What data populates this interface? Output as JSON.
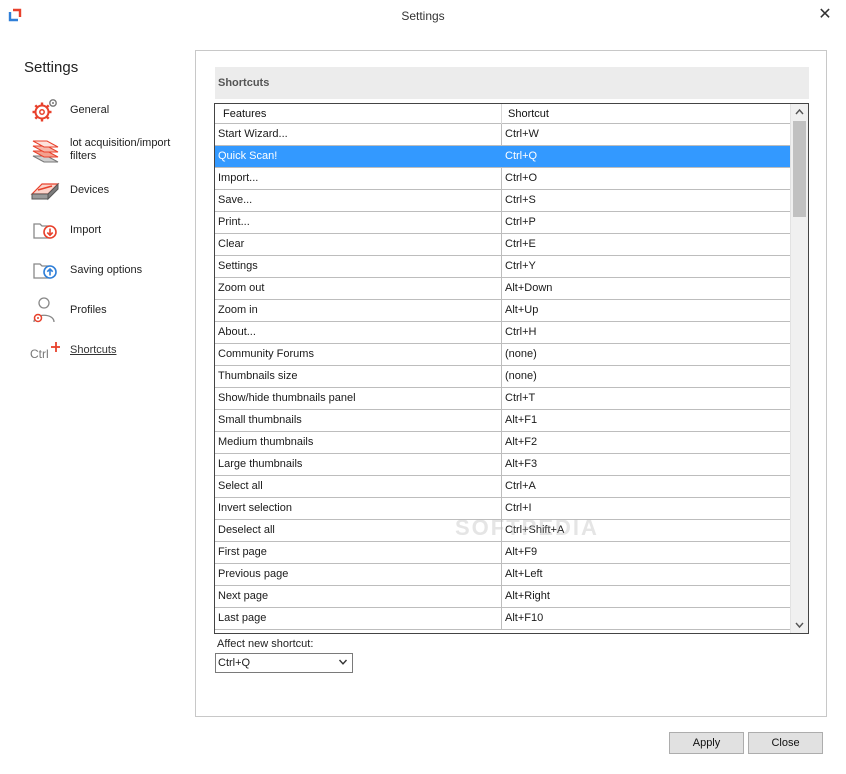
{
  "window": {
    "title": "Settings",
    "close_glyph": "✕"
  },
  "sidebar": {
    "title": "Settings",
    "items": [
      {
        "label": "General",
        "icon": "gear-icon"
      },
      {
        "label": "lot acquisition/import filters",
        "icon": "document-stack-icon"
      },
      {
        "label": "Devices",
        "icon": "scanner-icon"
      },
      {
        "label": "Import",
        "icon": "import-icon"
      },
      {
        "label": "Saving options",
        "icon": "save-upload-icon"
      },
      {
        "label": "Profiles",
        "icon": "user-gear-icon"
      },
      {
        "label": "Shortcuts",
        "icon": "ctrl-shortcut-icon"
      }
    ]
  },
  "section": {
    "title": "Shortcuts"
  },
  "grid": {
    "columns": [
      "Features",
      "Shortcut"
    ],
    "rows": [
      [
        "Start Wizard...",
        "Ctrl+W"
      ],
      [
        "Quick Scan!",
        "Ctrl+Q"
      ],
      [
        "Import...",
        "Ctrl+O"
      ],
      [
        "Save...",
        "Ctrl+S"
      ],
      [
        "Print...",
        "Ctrl+P"
      ],
      [
        "Clear",
        "Ctrl+E"
      ],
      [
        "Settings",
        "Ctrl+Y"
      ],
      [
        "Zoom out",
        "Alt+Down"
      ],
      [
        "Zoom in",
        "Alt+Up"
      ],
      [
        "About...",
        "Ctrl+H"
      ],
      [
        "Community Forums",
        "(none)"
      ],
      [
        "Thumbnails size",
        "(none)"
      ],
      [
        "Show/hide thumbnails panel",
        "Ctrl+T"
      ],
      [
        "Small thumbnails",
        "Alt+F1"
      ],
      [
        "Medium thumbnails",
        "Alt+F2"
      ],
      [
        "Large thumbnails",
        "Alt+F3"
      ],
      [
        "Select all",
        "Ctrl+A"
      ],
      [
        "Invert selection",
        "Ctrl+I"
      ],
      [
        "Deselect all",
        "Ctrl+Shift+A"
      ],
      [
        "First page",
        "Alt+F9"
      ],
      [
        "Previous page",
        "Alt+Left"
      ],
      [
        "Next page",
        "Alt+Right"
      ],
      [
        "Last page",
        "Alt+F10"
      ]
    ],
    "selected_row_index": 1
  },
  "affect": {
    "label": "Affect new shortcut:",
    "value": "Ctrl+Q"
  },
  "buttons": {
    "apply": "Apply",
    "close": "Close"
  },
  "watermark": "SOFTPEDIA",
  "colors": {
    "selection": "#3399ff",
    "accent_red": "#e8412c",
    "accent_blue": "#2f7fd8"
  }
}
